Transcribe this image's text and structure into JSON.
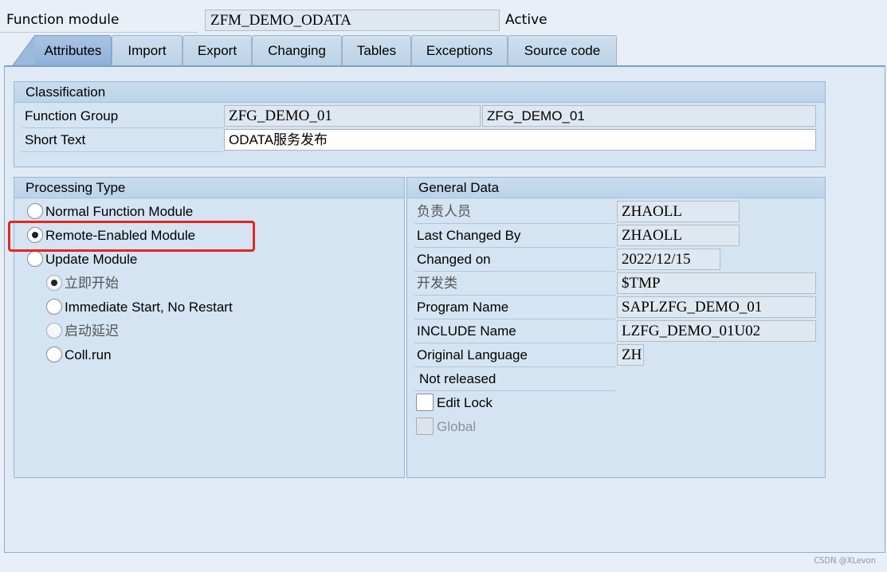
{
  "header": {
    "function_module_label": "Function module",
    "function_module_value": "ZFM_DEMO_ODATA",
    "status": "Active"
  },
  "tabs": [
    {
      "label": "Attributes",
      "active": true
    },
    {
      "label": "Import",
      "active": false
    },
    {
      "label": "Export",
      "active": false
    },
    {
      "label": "Changing",
      "active": false
    },
    {
      "label": "Tables",
      "active": false
    },
    {
      "label": "Exceptions",
      "active": false
    },
    {
      "label": "Source code",
      "active": false
    }
  ],
  "classification": {
    "title": "Classification",
    "function_group_label": "Function Group",
    "function_group_value": "ZFG_DEMO_01",
    "function_group_desc": "ZFG_DEMO_01",
    "short_text_label": "Short Text",
    "short_text_value": "ODATA服务发布"
  },
  "processing_type": {
    "title": "Processing Type",
    "options": [
      {
        "label": "Normal Function Module",
        "checked": false
      },
      {
        "label": "Remote-Enabled Module",
        "checked": true
      },
      {
        "label": "Update Module",
        "checked": false
      }
    ],
    "update_options": [
      {
        "label": "立即开始",
        "checked": true,
        "disabled": true
      },
      {
        "label": "Immediate Start, No Restart",
        "checked": false,
        "disabled": false
      },
      {
        "label": "启动延迟",
        "checked": false,
        "disabled": true
      },
      {
        "label": "Coll.run",
        "checked": false,
        "disabled": false
      }
    ],
    "highlight_color": "#e8251f"
  },
  "general_data": {
    "title": "General Data",
    "rows": [
      {
        "label": "负责人员",
        "value": "ZHAOLL"
      },
      {
        "label": "Last Changed By",
        "value": "ZHAOLL"
      },
      {
        "label": "Changed on",
        "value": "2022/12/15"
      },
      {
        "label": "开发类",
        "value": "$TMP"
      },
      {
        "label": "Program Name",
        "value": "SAPLZFG_DEMO_01"
      },
      {
        "label": "INCLUDE Name",
        "value": "LZFG_DEMO_01U02"
      },
      {
        "label": "Original Language",
        "value": "ZH"
      }
    ],
    "release_status": "Not released",
    "edit_lock_label": "Edit Lock",
    "edit_lock_checked": false,
    "global_label": "Global",
    "global_checked": false
  },
  "watermark": "CSDN @XLevon"
}
